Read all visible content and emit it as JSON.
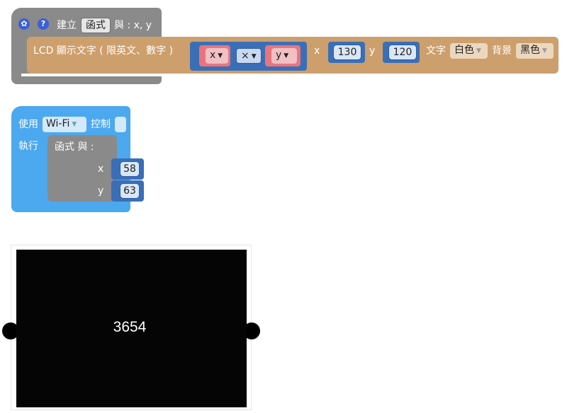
{
  "block1": {
    "settings_icon": "gear-icon",
    "help_icon": "help-icon",
    "prefix": "建立",
    "func_name": "函式",
    "suffix": "與 : x, y",
    "lcd_label": "LCD 顯示文字 ( 限英文、數字 )",
    "var1": "x",
    "op": "×",
    "var2": "y",
    "x_label": "x",
    "x_value": "130",
    "y_label": "y",
    "y_value": "120",
    "text_label": "文字",
    "text_color": "白色",
    "bg_label": "背景",
    "bg_color": "黑色"
  },
  "block2": {
    "use_label": "使用",
    "network": "Wi-Fi",
    "control_label": "控制",
    "exec_label": "執行",
    "func_call": "函式 與 :",
    "x_label": "x",
    "x_value": "58",
    "y_label": "y",
    "y_value": "63"
  },
  "display": {
    "value": "3654"
  },
  "colors": {
    "procedure": "#8a8a8a",
    "lcd_block": "#cd9f6c",
    "math_block": "#3a6fb8",
    "variable": "#e8757e",
    "wifi_block": "#4ca8ef",
    "screen": "#050505"
  }
}
